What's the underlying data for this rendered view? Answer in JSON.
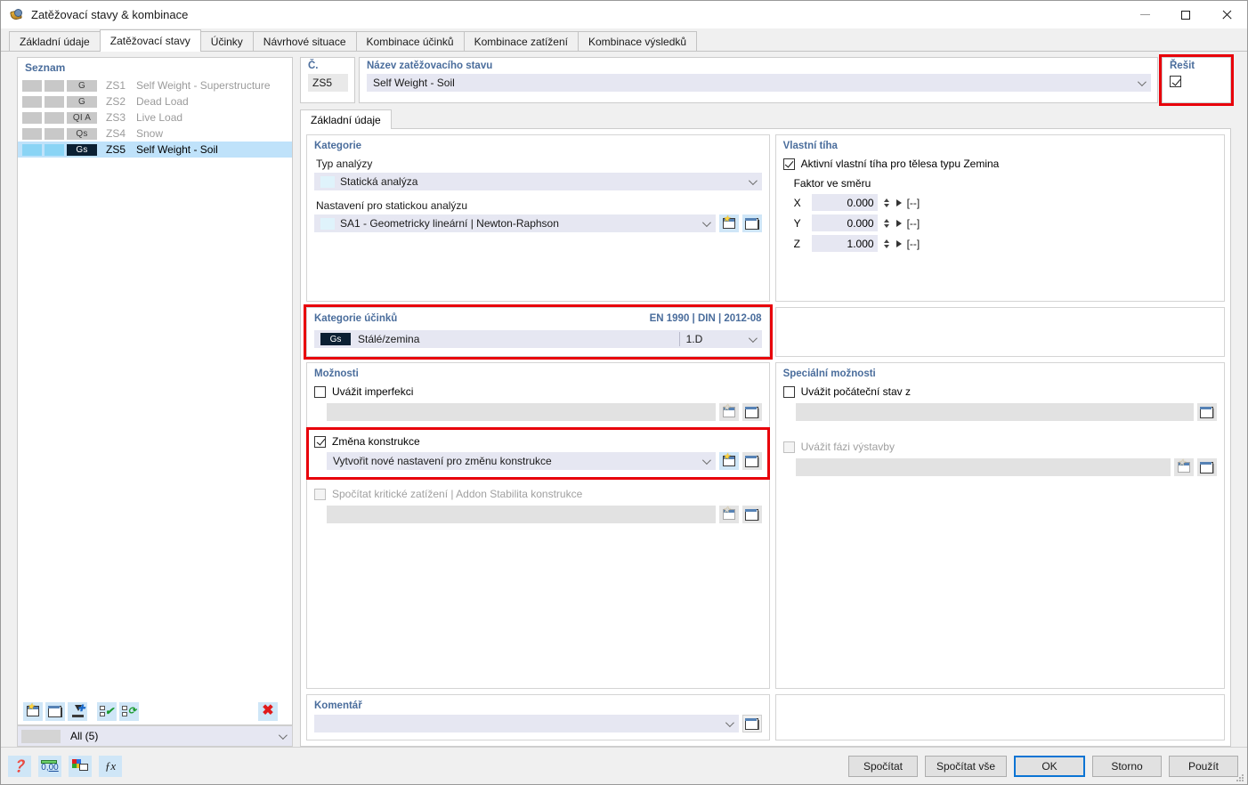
{
  "window": {
    "title": "Zatěžovací stavy & kombinace",
    "icon": "load-cases-icon",
    "minimize": "minimize-icon",
    "maximize": "maximize-icon",
    "close": "close-icon"
  },
  "tabs": [
    {
      "label": "Základní údaje",
      "active": false
    },
    {
      "label": "Zatěžovací stavy",
      "active": true
    },
    {
      "label": "Účinky",
      "active": false
    },
    {
      "label": "Návrhové situace",
      "active": false
    },
    {
      "label": "Kombinace účinků",
      "active": false
    },
    {
      "label": "Kombinace zatížení",
      "active": false
    },
    {
      "label": "Kombinace výsledků",
      "active": false
    }
  ],
  "list": {
    "header": "Seznam",
    "rows": [
      {
        "badge": "G",
        "no": "ZS1",
        "name": "Self Weight - Superstructure",
        "selected": false
      },
      {
        "badge": "G",
        "no": "ZS2",
        "name": "Dead Load",
        "selected": false
      },
      {
        "badge": "QI A",
        "no": "ZS3",
        "name": "Live Load",
        "selected": false
      },
      {
        "badge": "Qs",
        "no": "ZS4",
        "name": "Snow",
        "selected": false
      },
      {
        "badge": "Gs",
        "no": "ZS5",
        "name": "Self Weight - Soil",
        "selected": true
      }
    ],
    "toolbar": [
      {
        "name": "new-load-case-button",
        "icon": "new-window-icon"
      },
      {
        "name": "copy-load-case-button",
        "icon": "copy-window-icon"
      },
      {
        "name": "import-load-case-button",
        "icon": "import-icon"
      },
      {
        "name": "select-all-button",
        "icon": "check-all-icon"
      },
      {
        "name": "invert-selection-button",
        "icon": "invert-selection-icon"
      },
      {
        "name": "delete-load-case-button",
        "icon": "delete-x-icon"
      }
    ],
    "filter_value": "All (5)"
  },
  "header": {
    "number_label": "Č.",
    "number_value": "ZS5",
    "name_label": "Název zatěžovacího stavu",
    "name_value": "Self Weight - Soil",
    "solve_label": "Řešit",
    "solve_checked": true
  },
  "subtab": {
    "label": "Základní údaje"
  },
  "category": {
    "title": "Kategorie",
    "analysis_type_label": "Typ analýzy",
    "analysis_type_value": "Statická analýza",
    "static_settings_label": "Nastavení pro statickou analýzu",
    "static_settings_value": "SA1 - Geometricky lineární | Newton-Raphson",
    "new_button": "new-settings-icon",
    "edit_button": "edit-settings-icon"
  },
  "self_weight": {
    "title": "Vlastní tíha",
    "active_label": "Aktivní vlastní tíha pro tělesa typu Zemina",
    "active_checked": true,
    "factor_label": "Faktor ve směru",
    "factors": [
      {
        "axis": "X",
        "value": "0.000",
        "unit": "[--]"
      },
      {
        "axis": "Y",
        "value": "0.000",
        "unit": "[--]"
      },
      {
        "axis": "Z",
        "value": "1.000",
        "unit": "[--]"
      }
    ]
  },
  "action_category": {
    "title": "Kategorie účinků",
    "standard": "EN 1990 | DIN | 2012-08",
    "badge": "Gs",
    "value": "Stálé/zemina",
    "sub_value": "1.D"
  },
  "options": {
    "title": "Možnosti",
    "imperfection_label": "Uvážit imperfekci",
    "imperfection_checked": false,
    "imperfection_value": "",
    "structure_mod_label": "Změna konstrukce",
    "structure_mod_checked": true,
    "structure_mod_value": "Vytvořit nové nastavení pro změnu konstrukce",
    "critical_load_label": "Spočítat kritické zatížení | Addon Stabilita konstrukce",
    "critical_load_checked": false,
    "critical_load_value": ""
  },
  "special_options": {
    "title": "Speciální možnosti",
    "initial_state_label": "Uvážit počáteční stav z",
    "initial_state_checked": false,
    "initial_state_value": "",
    "construction_stage_label": "Uvážit fázi výstavby",
    "construction_stage_checked": false,
    "construction_stage_value": ""
  },
  "comment": {
    "title": "Komentář",
    "value": "",
    "pick_button": "comment-library-icon"
  },
  "statusbar": {
    "buttons": [
      {
        "name": "help-button",
        "icon": "question-icon"
      },
      {
        "name": "decimals-button",
        "icon": "number-format-icon"
      },
      {
        "name": "colors-button",
        "icon": "color-legend-icon"
      },
      {
        "name": "formula-button",
        "icon": "function-icon"
      }
    ]
  },
  "footer": {
    "calculate": "Spočítat",
    "calculate_all": "Spočítat vše",
    "ok": "OK",
    "cancel": "Storno",
    "apply": "Použít"
  },
  "colors": {
    "accent_blue": "#4a6d9c",
    "highlight_red": "#e8000a",
    "selection_blue": "#bfe2fa",
    "field_lavender": "#e6e7f2",
    "primary_button_border": "#0a74d4"
  }
}
